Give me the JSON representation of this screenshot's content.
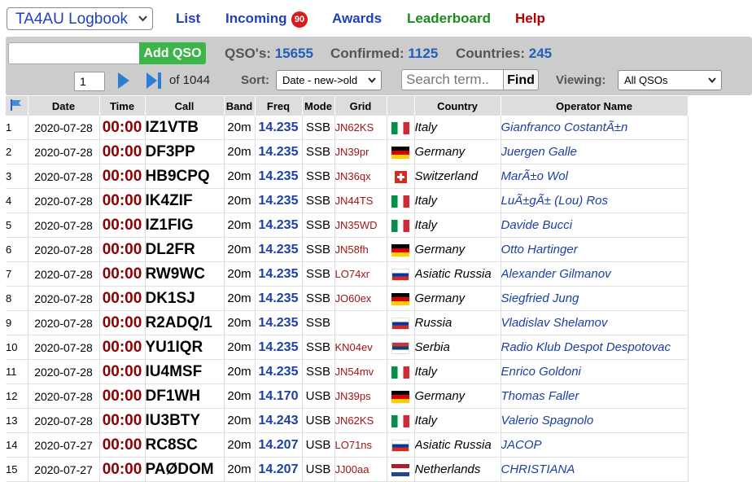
{
  "nav": {
    "logbook": "TA4AU Logbook",
    "list": "List",
    "incoming": "Incoming",
    "incoming_count": "90",
    "awards": "Awards",
    "leaderboard": "Leaderboard",
    "help": "Help"
  },
  "toolbar": {
    "qso_input": "",
    "add_label": "Add QSO",
    "qsos_label": "QSO's:",
    "qsos_value": "15655",
    "confirmed_label": "Confirmed:",
    "confirmed_value": "1125",
    "countries_label": "Countries:",
    "countries_value": "245",
    "page_value": "1",
    "of_pages": "of 1044",
    "sort_label": "Sort:",
    "sort_value": "Date - new->old",
    "search_placeholder": "Search term..",
    "find_label": "Find",
    "viewing_label": "Viewing:",
    "viewing_value": "All QSOs"
  },
  "colors": {
    "nav_blue": "#1f3fbf",
    "leaderboard": "#1c8a1c",
    "help": "#b00000",
    "add_green": "#3cb64a"
  },
  "table": {
    "columns": [
      "Date",
      "Time",
      "Call",
      "Band",
      "Freq",
      "Mode",
      "Grid",
      "Country",
      "Operator Name"
    ],
    "rows": [
      {
        "n": "1",
        "date": "2020-07-28",
        "time": "00:00",
        "call": "IZ1VTB",
        "band": "20m",
        "freq": "14.235",
        "mode": "SSB",
        "grid": "JN62KS",
        "flag": "it",
        "country": "Italy",
        "op": "Gianfranco CostantÃ±n"
      },
      {
        "n": "2",
        "date": "2020-07-28",
        "time": "00:00",
        "call": "DF3PP",
        "band": "20m",
        "freq": "14.235",
        "mode": "SSB",
        "grid": "JN39pr",
        "flag": "de",
        "country": "Germany",
        "op": "Juergen Galle"
      },
      {
        "n": "3",
        "date": "2020-07-28",
        "time": "00:00",
        "call": "HB9CPQ",
        "band": "20m",
        "freq": "14.235",
        "mode": "SSB",
        "grid": "JN36qx",
        "flag": "ch",
        "country": "Switzerland",
        "op": "MarÃ±o Wol"
      },
      {
        "n": "4",
        "date": "2020-07-28",
        "time": "00:00",
        "call": "IK4ZIF",
        "band": "20m",
        "freq": "14.235",
        "mode": "SSB",
        "grid": "JN44TS",
        "flag": "it",
        "country": "Italy",
        "op": "LuÃ±gÃ± (Lou) Ros"
      },
      {
        "n": "5",
        "date": "2020-07-28",
        "time": "00:00",
        "call": "IZ1FIG",
        "band": "20m",
        "freq": "14.235",
        "mode": "SSB",
        "grid": "JN35WD",
        "flag": "it",
        "country": "Italy",
        "op": "Davide Bucci"
      },
      {
        "n": "6",
        "date": "2020-07-28",
        "time": "00:00",
        "call": "DL2FR",
        "band": "20m",
        "freq": "14.235",
        "mode": "SSB",
        "grid": "JN58fh",
        "flag": "de",
        "country": "Germany",
        "op": "Otto Hartinger"
      },
      {
        "n": "7",
        "date": "2020-07-28",
        "time": "00:00",
        "call": "RW9WC",
        "band": "20m",
        "freq": "14.235",
        "mode": "SSB",
        "grid": "LO74xr",
        "flag": "ru",
        "country": "Asiatic Russia",
        "op": "Alexander Gilmanov"
      },
      {
        "n": "8",
        "date": "2020-07-28",
        "time": "00:00",
        "call": "DK1SJ",
        "band": "20m",
        "freq": "14.235",
        "mode": "SSB",
        "grid": "JO60ex",
        "flag": "de",
        "country": "Germany",
        "op": "Siegfried Jung"
      },
      {
        "n": "9",
        "date": "2020-07-28",
        "time": "00:00",
        "call": "R2ADQ/1",
        "band": "20m",
        "freq": "14.235",
        "mode": "SSB",
        "grid": "",
        "flag": "ru",
        "country": "Russia",
        "op": "Vladislav Shelamov"
      },
      {
        "n": "10",
        "date": "2020-07-28",
        "time": "00:00",
        "call": "YU1IQR",
        "band": "20m",
        "freq": "14.235",
        "mode": "SSB",
        "grid": "KN04ev",
        "flag": "rs",
        "country": "Serbia",
        "op": "Radio Klub Despot Despotovac"
      },
      {
        "n": "11",
        "date": "2020-07-28",
        "time": "00:00",
        "call": "IU4MSF",
        "band": "20m",
        "freq": "14.235",
        "mode": "SSB",
        "grid": "JN54mv",
        "flag": "it",
        "country": "Italy",
        "op": "Enrico Goldoni"
      },
      {
        "n": "12",
        "date": "2020-07-28",
        "time": "00:00",
        "call": "DF1WH",
        "band": "20m",
        "freq": "14.170",
        "mode": "USB",
        "grid": "JN39ps",
        "flag": "de",
        "country": "Germany",
        "op": "Thomas Faller"
      },
      {
        "n": "13",
        "date": "2020-07-28",
        "time": "00:00",
        "call": "IU3BTY",
        "band": "20m",
        "freq": "14.243",
        "mode": "USB",
        "grid": "JN62KS",
        "flag": "it",
        "country": "Italy",
        "op": "Valerio Spagnolo"
      },
      {
        "n": "14",
        "date": "2020-07-27",
        "time": "00:00",
        "call": "RC8SC",
        "band": "20m",
        "freq": "14.207",
        "mode": "USB",
        "grid": "LO71ns",
        "flag": "ru",
        "country": "Asiatic Russia",
        "op": "JACOP"
      },
      {
        "n": "15",
        "date": "2020-07-27",
        "time": "00:00",
        "call": "PAØDOM",
        "band": "20m",
        "freq": "14.207",
        "mode": "USB",
        "grid": "JJ00aa",
        "flag": "nl",
        "country": "Netherlands",
        "op": "CHRISTIANA"
      }
    ]
  }
}
